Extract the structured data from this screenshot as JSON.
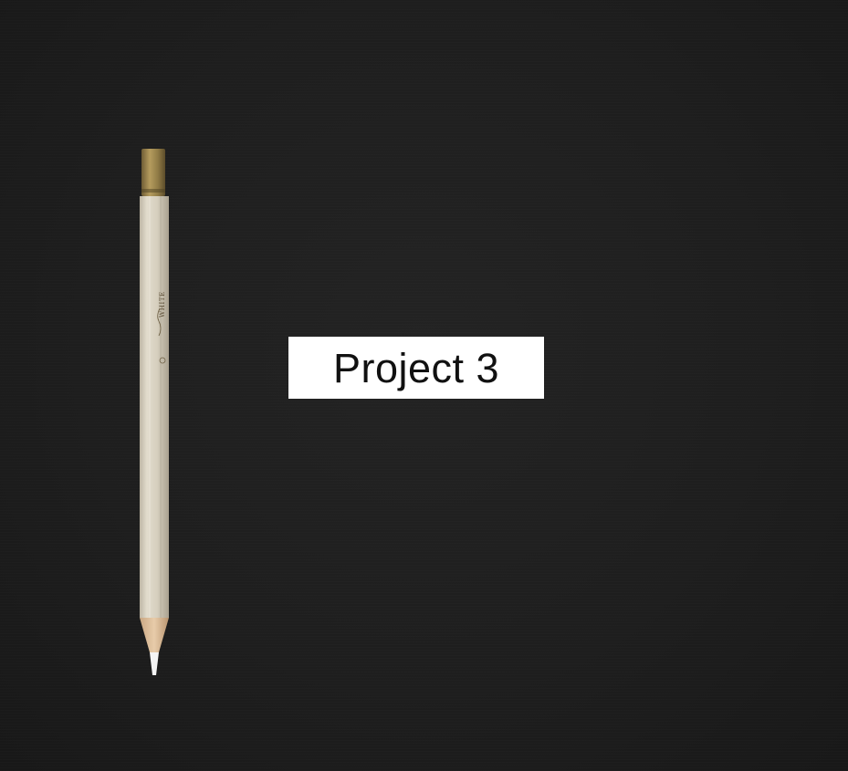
{
  "title_card": {
    "text": "Project 3"
  },
  "pencil": {
    "brand_text": "WHITE",
    "cap_color": "#a28a50",
    "body_color": "#d9d2c2",
    "lead_color": "#f4f4f4"
  },
  "background": {
    "color": "#1e1e1e"
  }
}
